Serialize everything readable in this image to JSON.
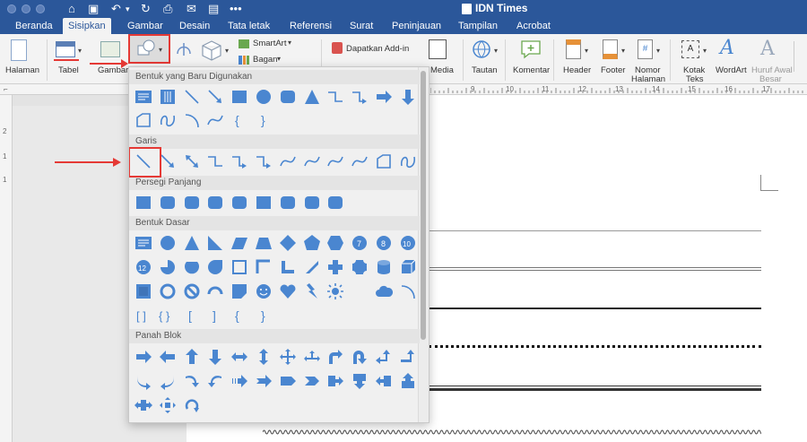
{
  "window": {
    "title": "IDN Times"
  },
  "tabs": [
    {
      "label": "Beranda"
    },
    {
      "label": "Sisipkan"
    },
    {
      "label": "Gambar"
    },
    {
      "label": "Desain"
    },
    {
      "label": "Tata letak"
    },
    {
      "label": "Referensi"
    },
    {
      "label": "Surat"
    },
    {
      "label": "Peninjauan"
    },
    {
      "label": "Tampilan"
    },
    {
      "label": "Acrobat"
    }
  ],
  "ribbon": {
    "halaman": "Halaman",
    "tabel": "Tabel",
    "gambar": "Gambar",
    "smartart": "SmartArt",
    "bagan": "Bagan",
    "addin": "Dapatkan Add-in",
    "media": "Media",
    "tautan": "Tautan",
    "komentar": "Komentar",
    "header": "Header",
    "footer": "Footer",
    "nomor_1": "Nomor",
    "nomor_2": "Halaman",
    "kotak_1": "Kotak",
    "kotak_2": "Teks",
    "wordart": "WordArt",
    "huruf_1": "Huruf Awal",
    "huruf_2": "Besar",
    "huruf_num": "17"
  },
  "ruler_numbers": [
    "9",
    "10",
    "11",
    "12",
    "13",
    "14",
    "15",
    "16",
    "17"
  ],
  "vruler_numbers": [
    "2",
    "1",
    "1"
  ],
  "shapes_menu": {
    "sections": [
      {
        "title": "Bentuk yang Baru Digunakan"
      },
      {
        "title": "Garis"
      },
      {
        "title": "Persegi Panjang"
      },
      {
        "title": "Bentuk Dasar"
      },
      {
        "title": "Panah Blok"
      }
    ]
  },
  "colors": {
    "accent": "#2b579a",
    "shape": "#4a86d0",
    "highlight": "#e53935"
  }
}
